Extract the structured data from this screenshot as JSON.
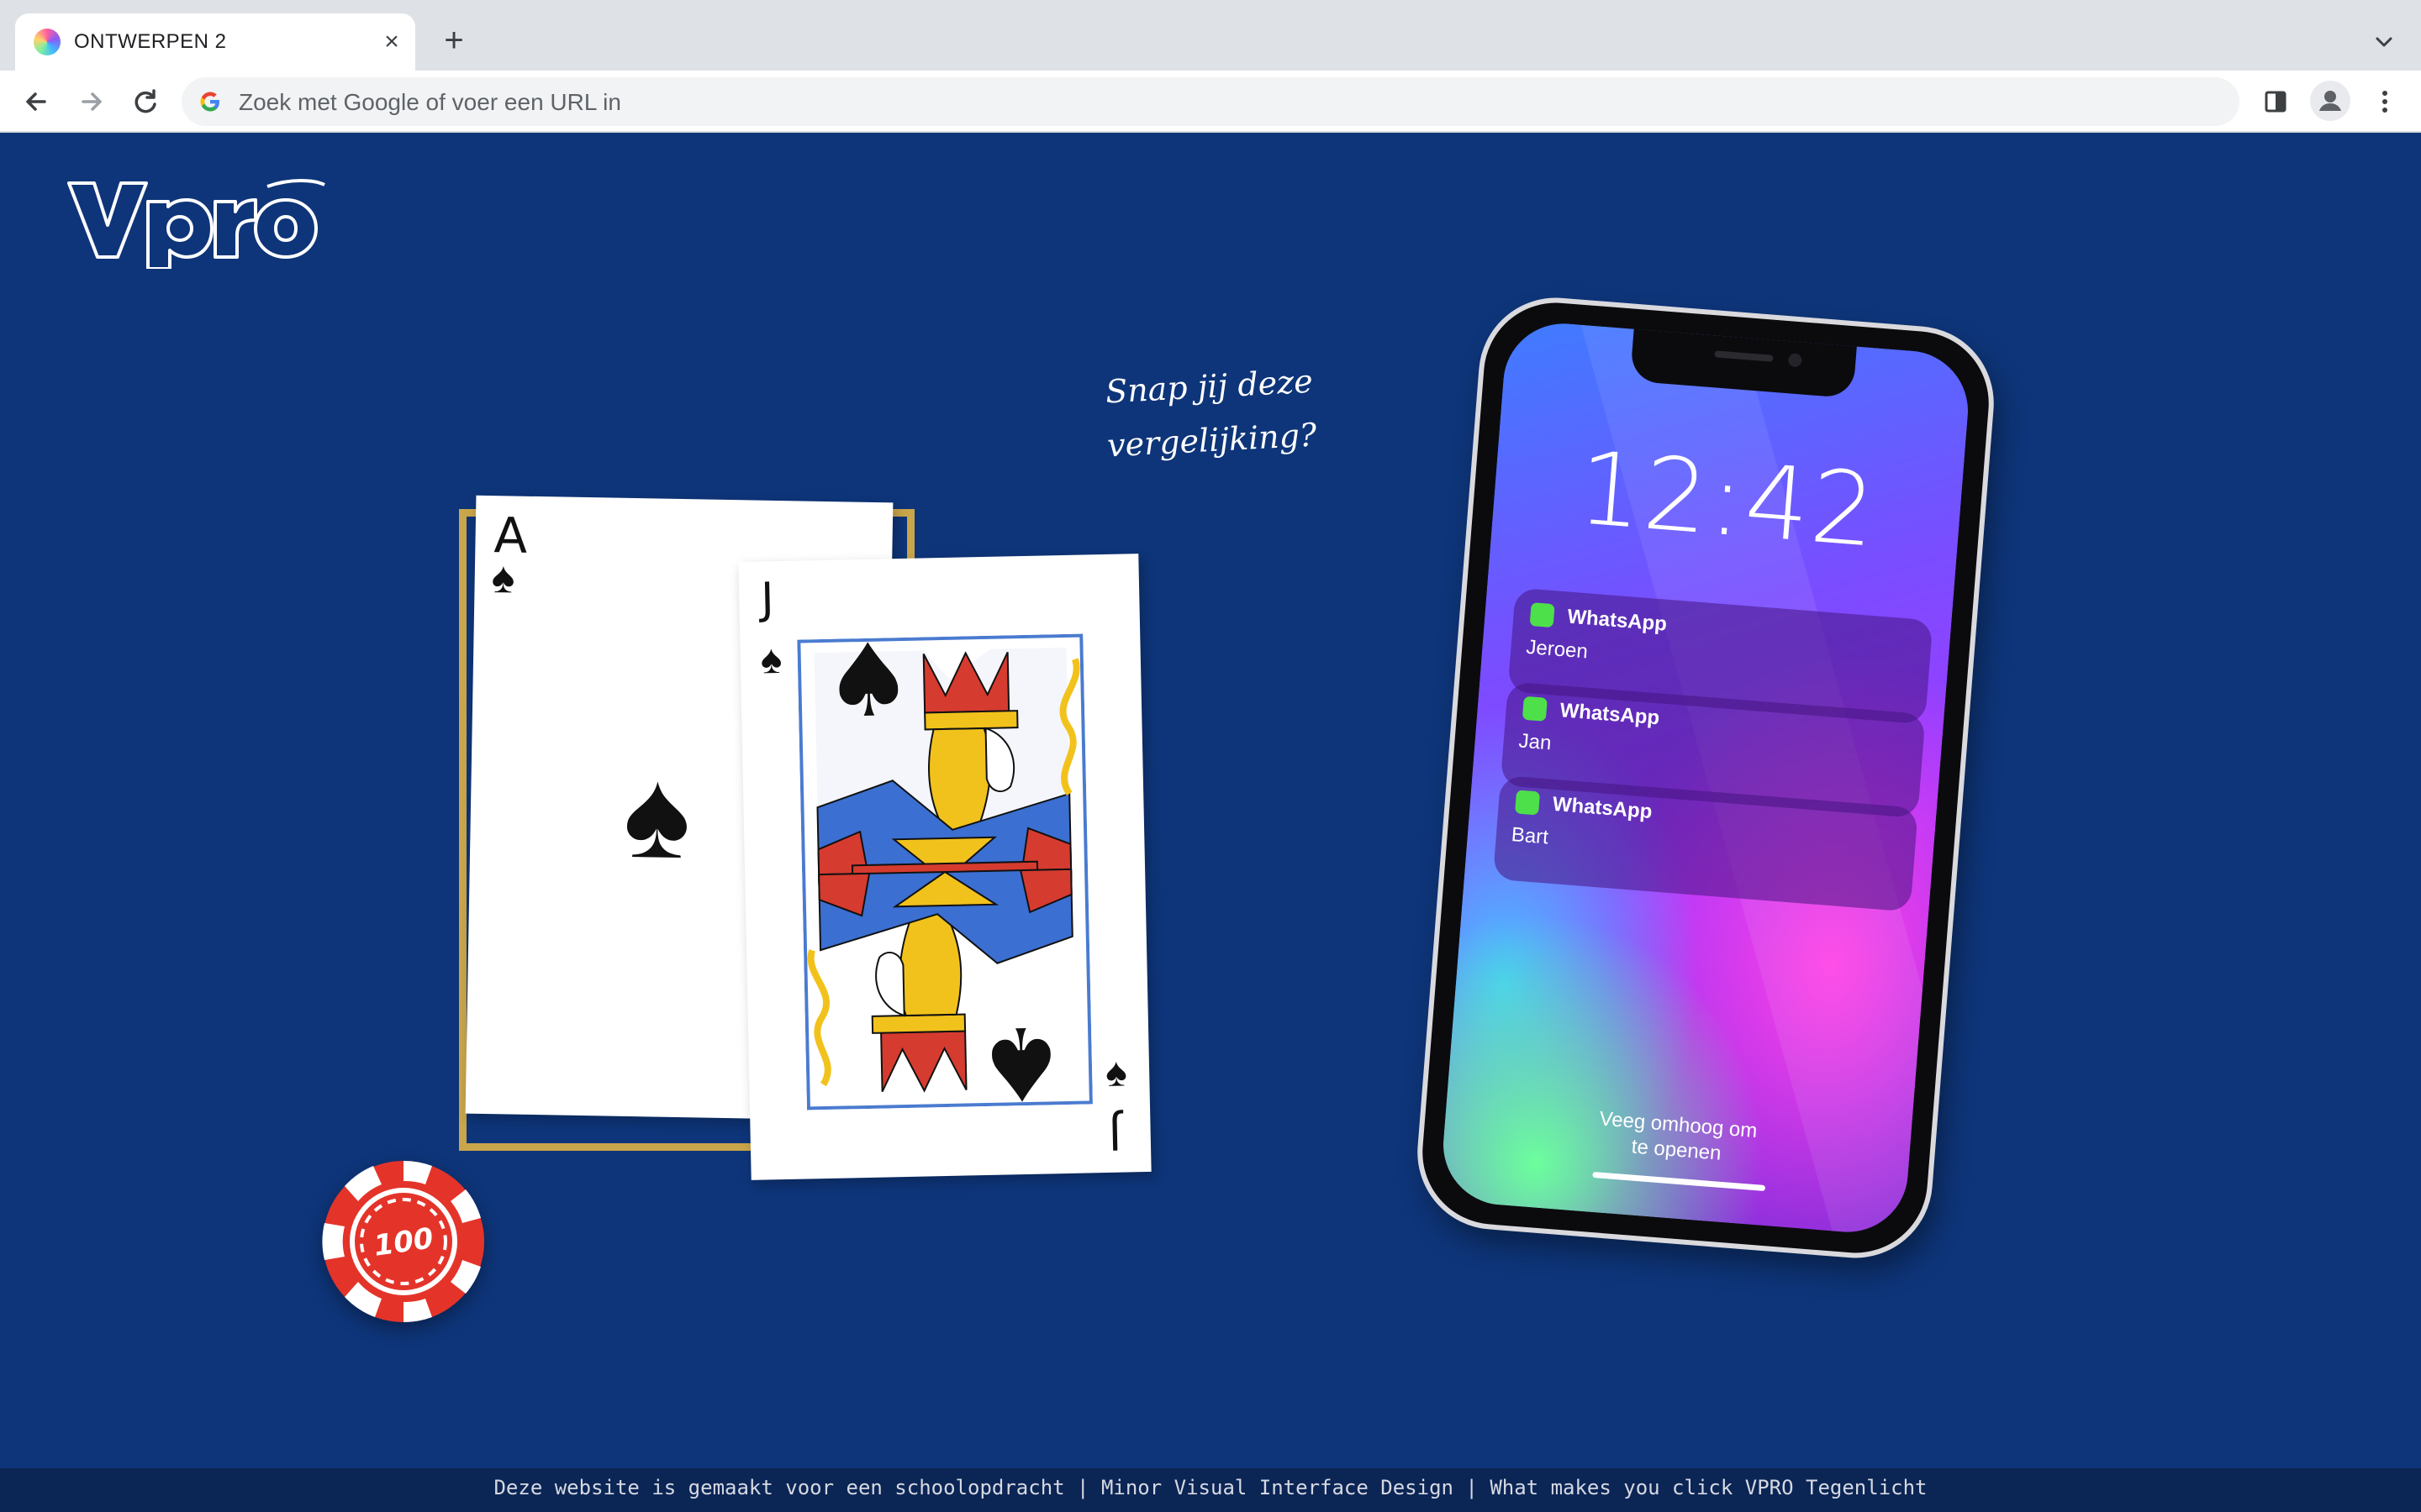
{
  "browser": {
    "tab_title": "ONTWERPEN 2",
    "tab_close_glyph": "×",
    "new_tab_glyph": "+",
    "address_placeholder": "Zoek met Google of voer een URL in",
    "icons": [
      "back-arrow-icon",
      "forward-arrow-icon",
      "reload-icon",
      "google-icon",
      "side-panel-icon",
      "profile-icon",
      "more-menu-icon",
      "chevron-down-icon"
    ]
  },
  "page": {
    "logo_alt": "vpro",
    "background_color": "#0e3579",
    "tagline": [
      "Snap jij deze",
      "vergelijking?"
    ],
    "cards": {
      "ace": {
        "rank": "A",
        "suit": "♠"
      },
      "jack": {
        "rank": "J",
        "suit": "♠"
      }
    },
    "chip_value": "100",
    "phone": {
      "time": "12:42",
      "notifications": [
        {
          "app": "WhatsApp",
          "sender": "Jeroen"
        },
        {
          "app": "WhatsApp",
          "sender": "Jan"
        },
        {
          "app": "WhatsApp",
          "sender": "Bart"
        }
      ],
      "swipe_hint": [
        "Veeg omhoog om",
        "te openen"
      ]
    }
  },
  "footer": {
    "text": "Deze website is gemaakt voor een schoolopdracht | Minor Visual Interface Design | What makes you click VPRO Tegenlicht"
  }
}
